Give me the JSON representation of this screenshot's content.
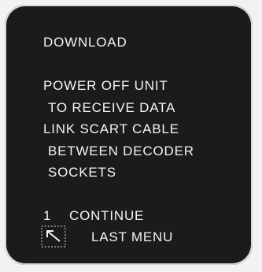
{
  "screen": {
    "title": "DOWNLOAD",
    "lines": [
      "POWER OFF UNIT",
      "TO RECEIVE DATA",
      "LINK  SCART CABLE",
      "BETWEEN DECODER",
      "SOCKETS"
    ],
    "options": [
      {
        "key": "1",
        "label": "CONTINUE"
      },
      {
        "key_icon": "back-arrow-icon",
        "label": "LAST MENU"
      }
    ]
  }
}
